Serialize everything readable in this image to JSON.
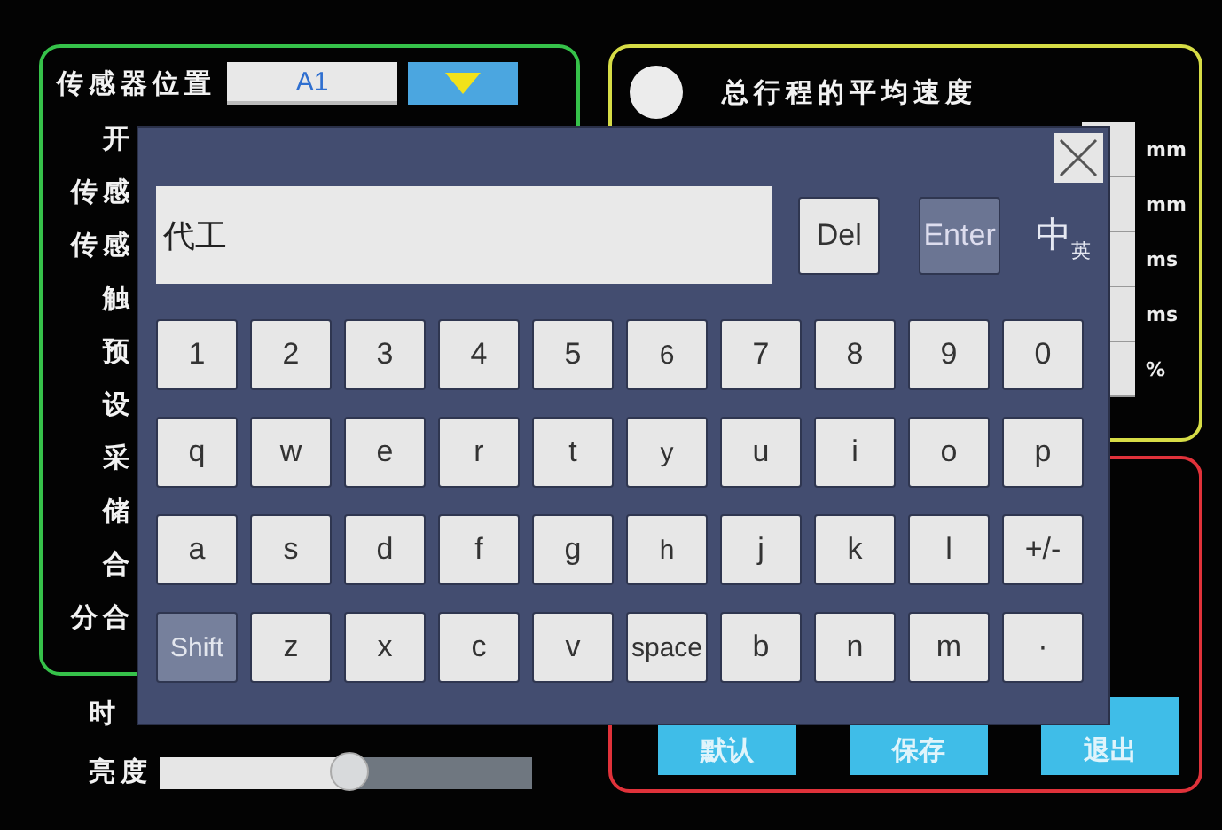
{
  "sensor_panel": {
    "label": "传感器位置",
    "value": "A1",
    "rows": [
      "开",
      "传感",
      "传感",
      "触",
      "预",
      "设",
      "采",
      "储",
      "合",
      "分合"
    ]
  },
  "clock_label": "时",
  "brightness": {
    "label": "亮度",
    "level": 0.51
  },
  "speed_panel": {
    "title": "总行程的平均速度",
    "selected": false,
    "units": [
      "mm",
      "mm",
      "ms",
      "ms",
      "%"
    ]
  },
  "action_panel": {
    "buttons": [
      "默认",
      "保存",
      "退出"
    ]
  },
  "keyboard": {
    "input_value": "代工",
    "del": "Del",
    "enter": "Enter",
    "lang_main": "中",
    "lang_sub": "英",
    "rows": [
      [
        {
          "label": "1",
          "kind": "key"
        },
        {
          "label": "2",
          "kind": "key"
        },
        {
          "label": "3",
          "kind": "key"
        },
        {
          "label": "4",
          "kind": "key"
        },
        {
          "label": "5",
          "kind": "key"
        },
        {
          "label": "6",
          "kind": "key"
        },
        {
          "label": "7",
          "kind": "key"
        },
        {
          "label": "8",
          "kind": "key"
        },
        {
          "label": "9",
          "kind": "key"
        },
        {
          "label": "0",
          "kind": "key"
        }
      ],
      [
        {
          "label": "q",
          "kind": "key"
        },
        {
          "label": "w",
          "kind": "key"
        },
        {
          "label": "e",
          "kind": "key"
        },
        {
          "label": "r",
          "kind": "key"
        },
        {
          "label": "t",
          "kind": "key"
        },
        {
          "label": "y",
          "kind": "key"
        },
        {
          "label": "u",
          "kind": "key"
        },
        {
          "label": "i",
          "kind": "key"
        },
        {
          "label": "o",
          "kind": "key"
        },
        {
          "label": "p",
          "kind": "key"
        }
      ],
      [
        {
          "label": "a",
          "kind": "key"
        },
        {
          "label": "s",
          "kind": "key"
        },
        {
          "label": "d",
          "kind": "key"
        },
        {
          "label": "f",
          "kind": "key"
        },
        {
          "label": "g",
          "kind": "key"
        },
        {
          "label": "h",
          "kind": "key"
        },
        {
          "label": "j",
          "kind": "key"
        },
        {
          "label": "k",
          "kind": "key"
        },
        {
          "label": "l",
          "kind": "key"
        },
        {
          "label": "+/-",
          "kind": "key"
        }
      ],
      [
        {
          "label": "Shift",
          "kind": "modifier"
        },
        {
          "label": "z",
          "kind": "key"
        },
        {
          "label": "x",
          "kind": "key"
        },
        {
          "label": "c",
          "kind": "key"
        },
        {
          "label": "v",
          "kind": "key"
        },
        {
          "label": "space",
          "kind": "key"
        },
        {
          "label": "b",
          "kind": "key"
        },
        {
          "label": "n",
          "kind": "key"
        },
        {
          "label": "m",
          "kind": "key"
        },
        {
          "label": "·",
          "kind": "key"
        }
      ]
    ]
  }
}
